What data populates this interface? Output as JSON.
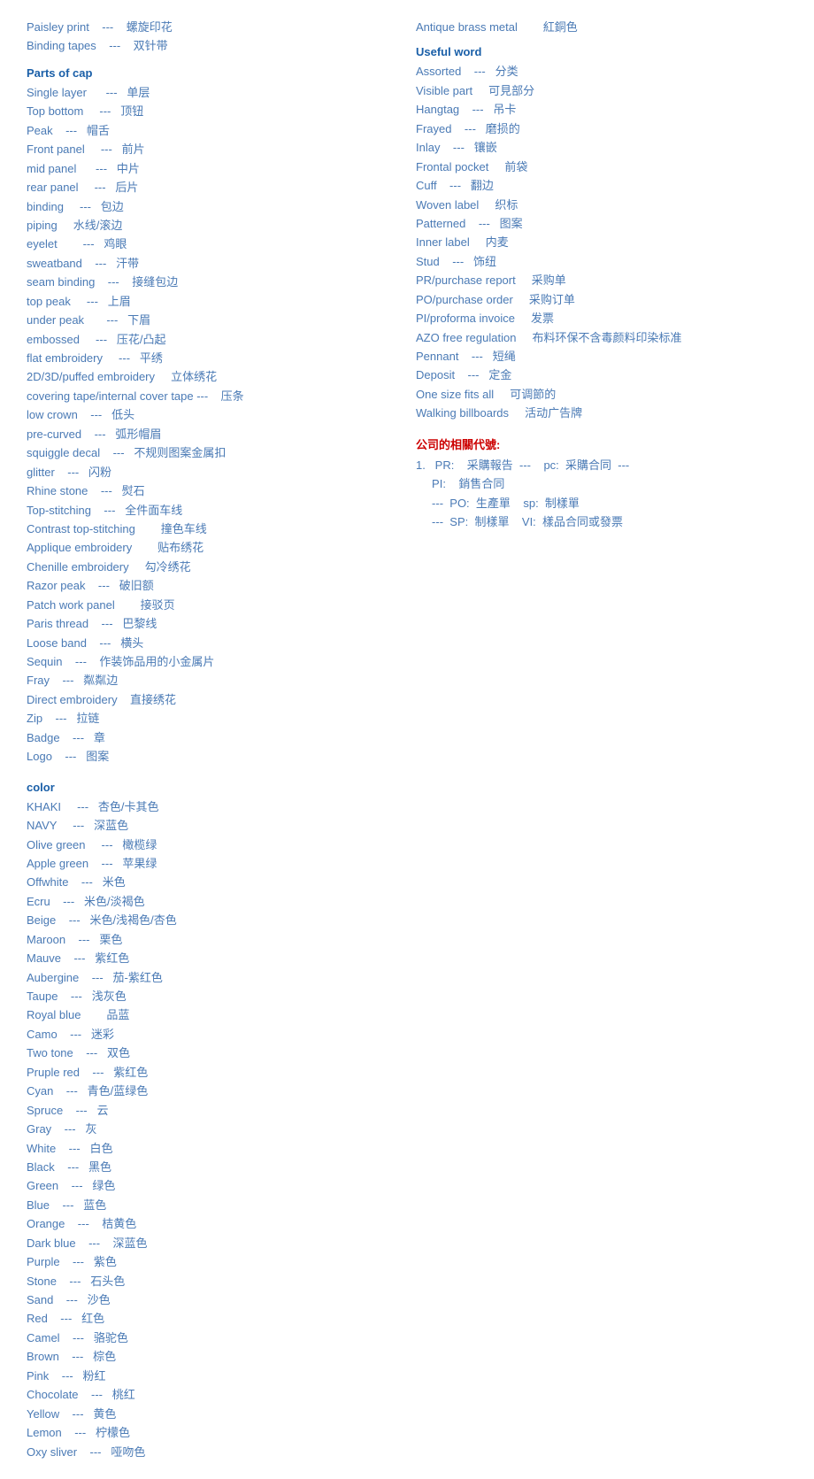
{
  "left": {
    "intro_lines": [
      "Paisley print    ---    螺旋印花",
      "Binding tapes    ---    双针带"
    ],
    "parts_title": "Parts of cap",
    "parts_lines": [
      "Single layer      ---   单层",
      "Top bottom     ---   顶钮",
      "Peak    ---   帽舌",
      "Front panel     ---   前片",
      "mid panel      ---   中片",
      "rear panel     ---   后片",
      "binding     ---   包边",
      "piping     水线/滚边",
      "eyelet        ---   鸡眼",
      "sweatband    ---   汗带",
      "seam binding    ---    接缝包边",
      "top peak     ---   上眉",
      "under peak       ---   下眉",
      "embossed     ---   压花/凸起",
      "flat embroidery     ---   平绣",
      "2D/3D/puffed embroidery     立体绣花",
      "covering tape/internal cover tape ---    压条",
      "low crown    ---   低头",
      "pre-curved    ---   弧形帽眉",
      "squiggle decal    ---   不规则图案金属扣",
      "glitter    ---   闪粉",
      "Rhine stone    ---   熨石",
      "Top-stitching    ---   全件面车线",
      "Contrast top-stitching        撞色车线",
      "Applique embroidery        贴布绣花",
      "Chenille embroidery     勾冷绣花",
      "Razor peak    ---   破旧额",
      "Patch work panel        接驳页",
      "Paris thread    ---   巴黎线",
      "Loose band    ---   横头",
      "Sequin    ---    作装饰品用的小金属片",
      "Fray    ---   粼粼边",
      "Direct embroidery    直接绣花",
      "Zip    ---   拉链",
      "Badge    ---   章",
      "Logo    ---   图案"
    ],
    "color_title": "color",
    "color_lines": [
      "KHAKI     ---   杏色/卡其色",
      "NAVY     ---   深蓝色",
      "Olive green     ---   橄榄绿",
      "Apple green    ---   苹果绿",
      "Offwhite    ---   米色",
      "Ecru    ---   米色/淡褐色",
      "Beige    ---   米色/浅褐色/杏色",
      "Maroon    ---   栗色",
      "Mauve    ---   紫红色",
      "Aubergine    ---   茄-紫红色",
      "Taupe    ---   浅灰色",
      "Royal blue        品蓝",
      "Camo    ---   迷彩",
      "Two tone    ---   双色",
      "Pruple red    ---   紫红色",
      "Cyan    ---   青色/蓝绿色",
      "Spruce    ---   云",
      "Gray    ---   灰",
      "White    ---   白色",
      "Black    ---   黑色",
      "Green    ---   绿色",
      "Blue    ---   蓝色",
      "Orange    ---    桔黄色",
      "Dark blue    ---    深蓝色",
      "Purple    ---   紫色",
      "Stone    ---   石头色",
      "Sand    ---   沙色",
      "Red    ---   红色",
      "Camel    ---   骆驼色",
      "Brown    ---   棕色",
      "Pink    ---   粉红",
      "Chocolate    ---   桃红",
      "Yellow    ---   黄色",
      "Lemon    ---   柠檬色",
      "Oxy sliver    ---   哑吻色"
    ]
  },
  "right": {
    "antique_line": "Antique brass metal        紅銅色",
    "useful_title": "Useful word",
    "useful_lines": [
      "Assorted    ---   分类",
      "Visible part     可見部分",
      "Hangtag    ---   吊卡",
      "Frayed    ---   磨损的",
      "Inlay    ---   镶嵌",
      "Frontal pocket     前袋",
      "Cuff    ---   翻边",
      "Woven label     织标",
      "Patterned    ---   图案",
      "Inner label     内麦",
      "Stud    ---   饰纽",
      "PR/purchase report     采购单",
      "PO/purchase order     采购订单",
      "PI/proforma invoice     发票",
      "AZO free regulation     布料环保不含毒颜料印染标准",
      "Pennant    ---   短绳",
      "Deposit    ---   定金",
      "One size fits all     可调節的",
      "Walking billboards     活动广告牌"
    ],
    "company_title": "公司的相關代號:",
    "company_lines": [
      "1.   PR:    采購報告  ---    pc:  采購合同  ---",
      "     PI:    銷售合同",
      "     ---  PO:  生產單    sp:  制樣單",
      "     ---  SP:  制樣單    VI:  樣品合同或發票"
    ],
    "one_line": "One    可調節的"
  }
}
